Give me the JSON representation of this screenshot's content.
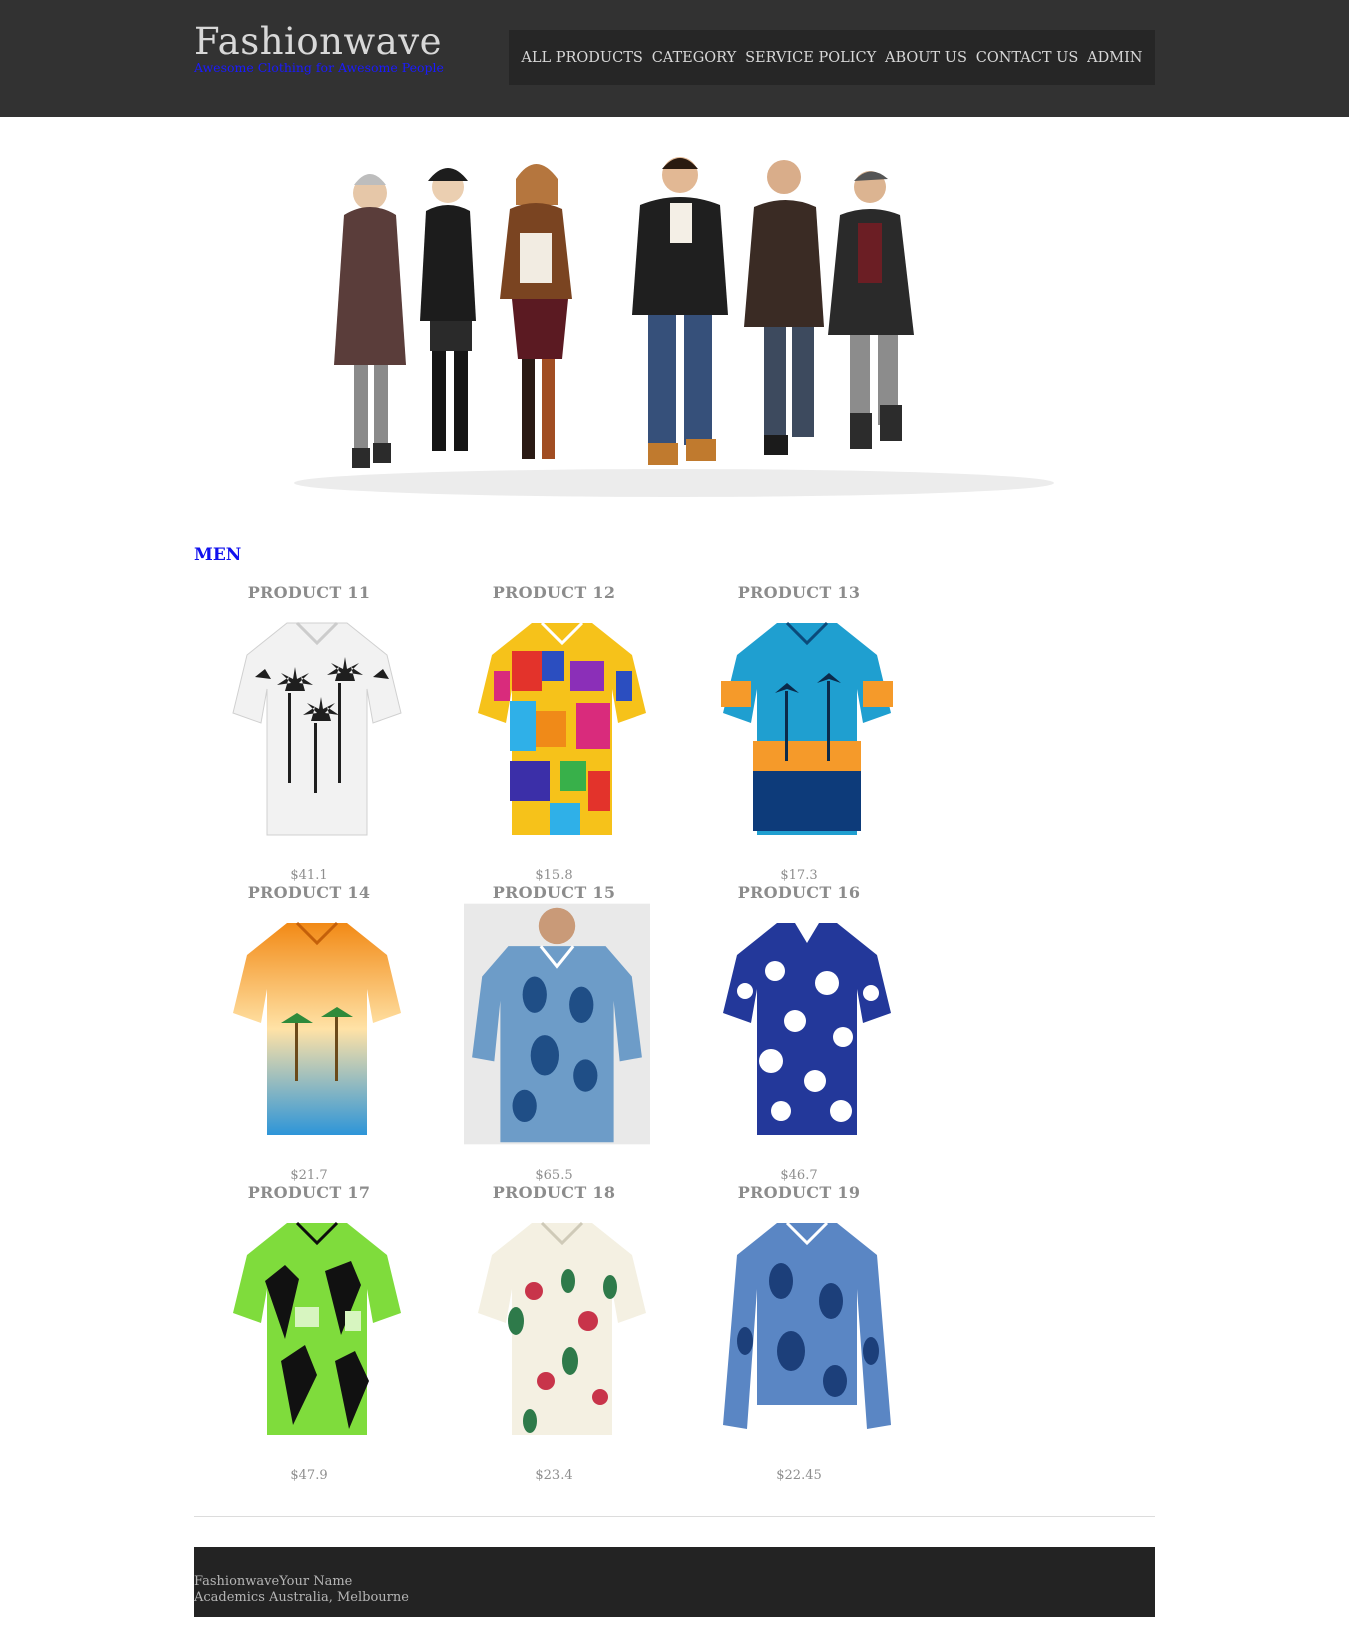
{
  "header": {
    "brand_title": "Fashionwave",
    "brand_tagline": "Awesome Clothing for Awesome People",
    "nav": [
      {
        "label": "ALL PRODUCTS"
      },
      {
        "label": "CATEGORY"
      },
      {
        "label": "SERVICE POLICY"
      },
      {
        "label": "ABOUT US"
      },
      {
        "label": "CONTACT US"
      },
      {
        "label": "ADMIN"
      }
    ]
  },
  "hero": {
    "icon": "hero-banner-image"
  },
  "section": {
    "title": "MEN"
  },
  "products": [
    {
      "name": "PRODUCT 11",
      "price": "$41.1",
      "pattern": "palm-white"
    },
    {
      "name": "PRODUCT 12",
      "price": "$15.8",
      "pattern": "patchwork"
    },
    {
      "name": "PRODUCT 13",
      "price": "$17.3",
      "pattern": "sunset-blue"
    },
    {
      "name": "PRODUCT 14",
      "price": "$21.7",
      "pattern": "beach-orange"
    },
    {
      "name": "PRODUCT 15",
      "price": "$65.5",
      "pattern": "paisley-model"
    },
    {
      "name": "PRODUCT 16",
      "price": "$46.7",
      "pattern": "floral-navy"
    },
    {
      "name": "PRODUCT 17",
      "price": "$47.9",
      "pattern": "palm-green"
    },
    {
      "name": "PRODUCT 18",
      "price": "$23.4",
      "pattern": "floral-cream"
    },
    {
      "name": "PRODUCT 19",
      "price": "$22.45",
      "pattern": "paisley-long"
    }
  ],
  "footer": {
    "line1": "FashionwaveYour Name",
    "line2": "Academics Australia, Melbourne"
  }
}
